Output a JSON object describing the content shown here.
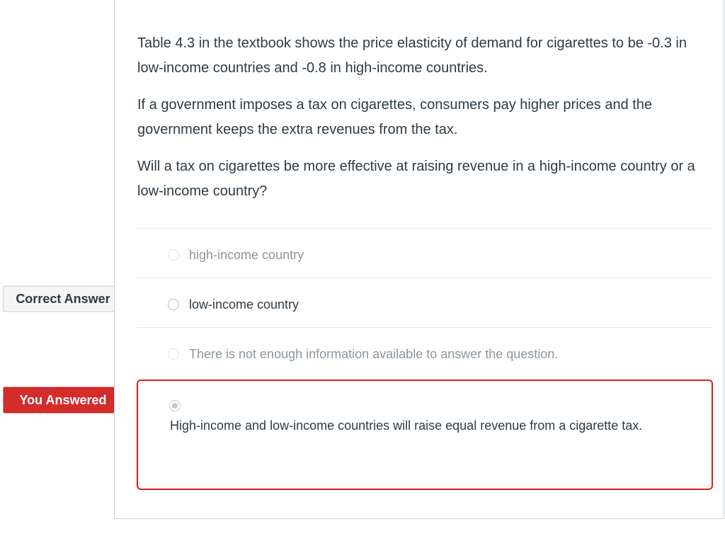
{
  "question": {
    "paragraphs": [
      "Table 4.3 in the textbook shows the price elasticity of demand for cigarettes to be -0.3 in low-income countries and -0.8 in high-income countries.",
      "If a government imposes a tax on cigarettes, consumers pay higher prices and the government keeps the extra revenues from the tax.",
      "Will a tax on cigarettes be more effective at raising revenue in a high-income country or a low-income country?"
    ]
  },
  "answers": [
    {
      "label": "high-income country"
    },
    {
      "label": "low-income country"
    },
    {
      "label": "There is not enough information available to answer the question."
    },
    {
      "label": "High-income and low-income countries will raise equal revenue from a cigarette tax."
    }
  ],
  "flags": {
    "correct": "Correct Answer",
    "you_answered": "You Answered"
  },
  "colors": {
    "correct_flag_bg": "#f5f5f5",
    "wrong_flag_bg": "#d42b2b",
    "wrong_border": "#e0191e",
    "text": "#2d3b45",
    "dim_text": "#8b969e"
  }
}
